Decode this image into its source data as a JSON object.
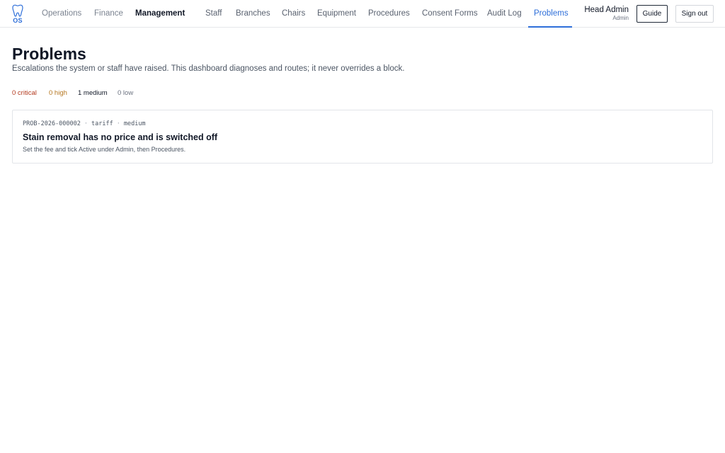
{
  "app": {
    "logo_text": "OS",
    "logo_icon": "tooth-icon"
  },
  "nav": {
    "sections": [
      {
        "label": "Operations",
        "active": false
      },
      {
        "label": "Finance",
        "active": false
      },
      {
        "label": "Management",
        "active": true
      }
    ],
    "tabs": [
      {
        "label": "Staff",
        "active": false
      },
      {
        "label": "Branches",
        "active": false
      },
      {
        "label": "Chairs",
        "active": false
      },
      {
        "label": "Equipment",
        "active": false
      },
      {
        "label": "Procedures",
        "active": false
      },
      {
        "label": "Consent Forms",
        "active": false
      },
      {
        "label": "Audit Log",
        "active": false
      },
      {
        "label": "Problems",
        "active": true
      }
    ]
  },
  "user": {
    "name": "Head Admin",
    "role": "Admin"
  },
  "header_buttons": {
    "guide_label": "Guide",
    "signout_label": "Sign out"
  },
  "page": {
    "title": "Problems",
    "subtitle": "Escalations the system or staff have raised. This dashboard diagnoses and routes; it never overrides a block."
  },
  "counts": {
    "critical": "0 critical",
    "high": "0 high",
    "medium": "1 medium",
    "low": "0 low"
  },
  "problems": [
    {
      "id": "PROB-2026-000002",
      "category": "tariff",
      "severity": "medium",
      "title": "Stain removal has no price and is switched off",
      "description": "Set the fee and tick Active under Admin, then Procedures."
    }
  ],
  "colors": {
    "accent": "#2e6fd9",
    "critical": "#b33a1f",
    "high": "#b5761f",
    "text": "#111827"
  }
}
